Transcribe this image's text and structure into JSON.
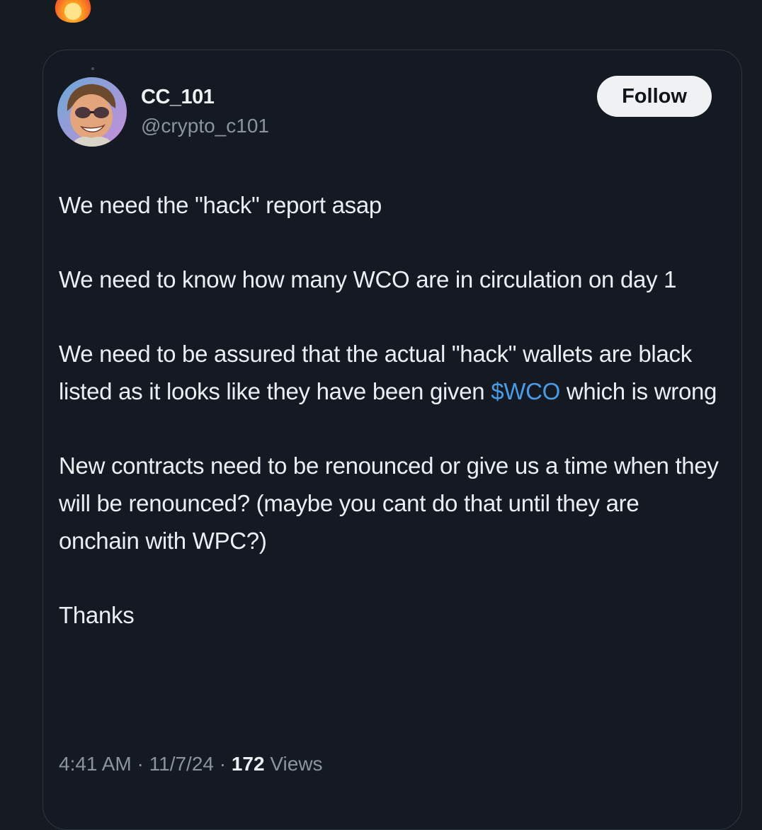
{
  "header": {
    "emoji_icon": "fire-emoji-icon"
  },
  "tweet": {
    "display_name": "CC_101",
    "handle": "@crypto_c101",
    "follow_label": "Follow",
    "paragraph_1": "We need the \"hack\" report asap",
    "paragraph_2": "We need to know how many WCO are in circulation on day 1",
    "paragraph_3_before": "We need to be assured that the actual \"hack\" wallets are black listed as it looks like they have been given ",
    "paragraph_3_cashtag": "$WCO",
    "paragraph_3_after": " which is wrong",
    "paragraph_4": "New contracts need to be renounced or give us a time when they will be renounced? (maybe you cant do that until they are onchain with WPC?)",
    "paragraph_5": "Thanks",
    "time": "4:41 AM",
    "separator": "·",
    "date": "11/7/24",
    "views_count": "172",
    "views_label": "Views"
  },
  "colors": {
    "background": "#161b22",
    "card_border": "#2f3640",
    "text": "#eceff1",
    "muted": "#8b949e",
    "link": "#4a9be6",
    "follow_bg": "#eff1f3"
  }
}
